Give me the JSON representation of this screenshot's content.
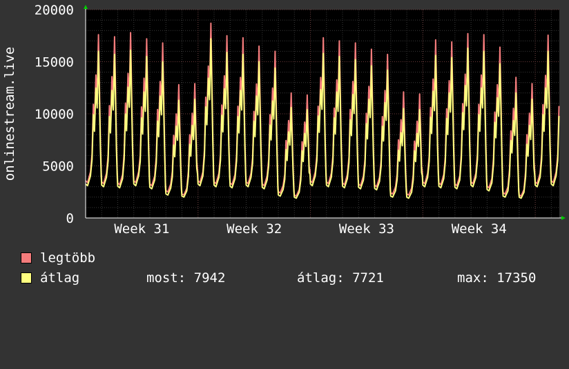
{
  "chart_data": {
    "type": "line",
    "ylabel": "onlinestream.live",
    "ylim": [
      0,
      20000
    ],
    "yticks": [
      0,
      5000,
      10000,
      15000,
      20000
    ],
    "x_unit": "day",
    "xlim": [
      0,
      29.5
    ],
    "x_tick_labels": [
      {
        "label": "Week 31",
        "day": 3.5
      },
      {
        "label": "Week 32",
        "day": 10.5
      },
      {
        "label": "Week 33",
        "day": 17.5
      },
      {
        "label": "Week 34",
        "day": 24.5
      }
    ],
    "series": [
      {
        "name": "legtöbb",
        "color": "#f47c7c",
        "daily_peak": [
          17600,
          17400,
          17800,
          17200,
          16800,
          12800,
          12900,
          18700,
          17500,
          17300,
          16500,
          16000,
          12000,
          11800,
          17300,
          17000,
          16800,
          16200,
          15700,
          12100,
          11900,
          17100,
          16900,
          17700,
          17600,
          16400,
          13500,
          12900,
          17550,
          17350
        ],
        "daily_low": [
          3400,
          3300,
          3200,
          3400,
          3100,
          2500,
          2200,
          3400,
          3300,
          3200,
          3300,
          3100,
          2400,
          2100,
          3400,
          3300,
          3200,
          3100,
          3000,
          2300,
          2200,
          3300,
          3200,
          3100,
          3300,
          2900,
          2300,
          2100,
          3300,
          3400
        ]
      },
      {
        "name": "átlag",
        "color": "#ffff80",
        "daily_peak": [
          16000,
          15700,
          16100,
          15500,
          15000,
          11300,
          11400,
          17200,
          15900,
          15700,
          15000,
          14400,
          10600,
          10400,
          15800,
          15500,
          15200,
          14600,
          14200,
          10500,
          10400,
          15600,
          15400,
          16300,
          16000,
          14800,
          12000,
          11400,
          16000,
          15800
        ],
        "daily_low": [
          3100,
          3000,
          2900,
          3100,
          2800,
          2200,
          2000,
          3100,
          3000,
          2900,
          3000,
          2800,
          2100,
          1900,
          3100,
          3000,
          2900,
          2800,
          2700,
          2000,
          1900,
          3000,
          2900,
          2800,
          3000,
          2600,
          2000,
          1900,
          3000,
          3100
        ]
      }
    ],
    "grid": true
  },
  "legend": [
    {
      "name": "legtöbb",
      "color": "#f47c7c"
    },
    {
      "name": "átlag",
      "color": "#ffff80"
    }
  ],
  "stats": {
    "now": "most: 7942",
    "avg": "átlag: 7721",
    "max": "max: 17350"
  }
}
